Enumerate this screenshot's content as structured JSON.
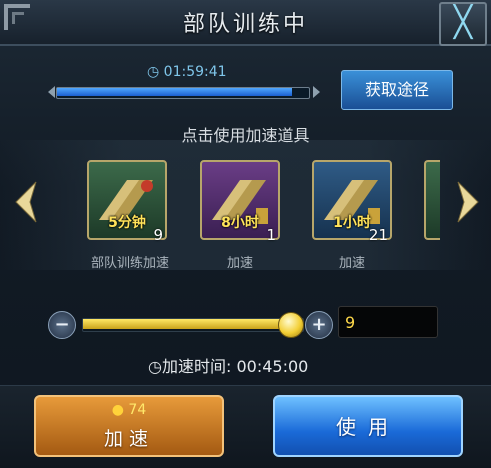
{
  "dialog": {
    "title": "部队训练中",
    "close_label": "╳"
  },
  "training": {
    "remaining_time": "01:59:41",
    "progress_fraction": 0.94
  },
  "get_method_button": "获取途径",
  "hint_text": "点击使用加速道具",
  "items": [
    {
      "label": "5分钟",
      "count": "9",
      "name": "部队训练加速",
      "theme": "green"
    },
    {
      "label": "8小时",
      "count": "1",
      "name": "加速",
      "theme": "purple"
    },
    {
      "label": "1小时",
      "count": "21",
      "name": "加速",
      "theme": "blue"
    }
  ],
  "slider": {
    "value_fraction": 0.95,
    "quantity": "9"
  },
  "speed_time": {
    "label": "加速时间:",
    "value": "00:45:00"
  },
  "buttons": {
    "speed_cost": "74",
    "speed_label": "加速",
    "use_label": "使用"
  },
  "colors": {
    "accent_blue": "#1a6ad8",
    "accent_orange": "#d07a22",
    "gold": "#ffe35a"
  }
}
